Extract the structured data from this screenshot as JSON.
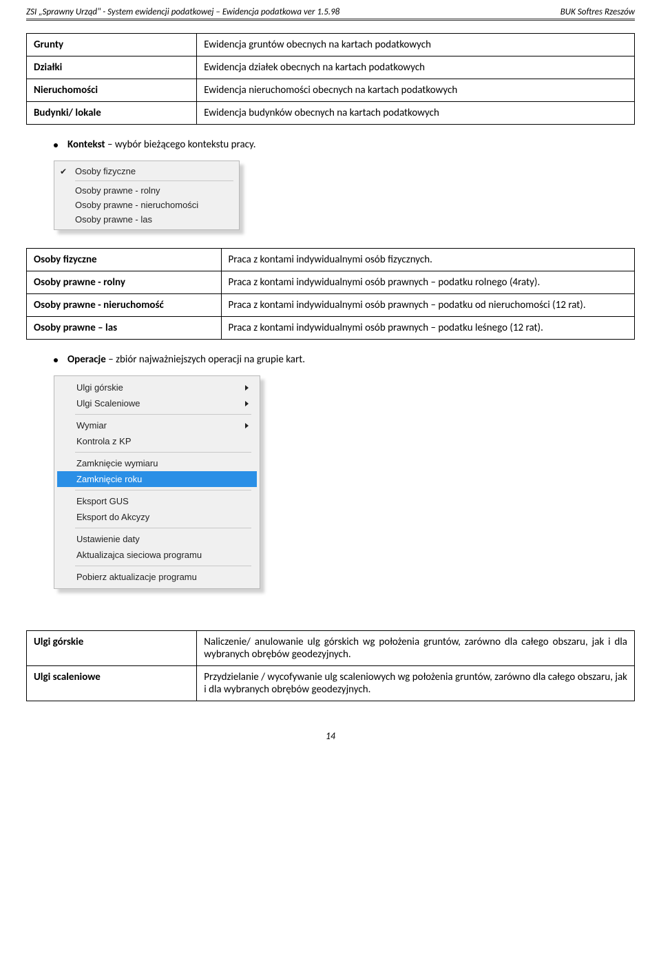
{
  "header": {
    "left": "ZSI „Sprawny Urząd\"  - System ewidencji podatkowej – Ewidencja podatkowa  ver 1.5.98",
    "right": "BUK Softres Rzeszów"
  },
  "table1": {
    "rows": [
      {
        "label": "Grunty",
        "desc": "Ewidencja gruntów obecnych na kartach podatkowych"
      },
      {
        "label": "Działki",
        "desc": "Ewidencja działek obecnych na kartach podatkowych"
      },
      {
        "label": "Nieruchomości",
        "desc": "Ewidencja nieruchomości obecnych na kartach podatkowych"
      },
      {
        "label": "Budynki/ lokale",
        "desc": "Ewidencja budynków obecnych na kartach podatkowych"
      }
    ]
  },
  "bullet1": {
    "bold": "Kontekst",
    "rest": " – wybór bieżącego kontekstu pracy."
  },
  "menuSmall": {
    "checked": "Osoby fizyczne",
    "items": [
      "Osoby prawne - rolny",
      "Osoby prawne - nieruchomości",
      "Osoby prawne - las"
    ]
  },
  "table2": {
    "rows": [
      {
        "label": "Osoby fizyczne",
        "desc": "Praca z kontami indywidualnymi osób fizycznych."
      },
      {
        "label": "Osoby prawne - rolny",
        "desc": "Praca z kontami indywidualnymi osób prawnych – podatku rolnego (4raty)."
      },
      {
        "label": "Osoby prawne - nieruchomość",
        "desc": "Praca z kontami indywidualnymi osób prawnych – podatku od nieruchomości  (12 rat)."
      },
      {
        "label": "Osoby prawne – las",
        "desc": "Praca z kontami indywidualnymi osób prawnych – podatku leśnego (12 rat)."
      }
    ]
  },
  "bullet2": {
    "bold": "Operacje",
    "rest": " – zbiór najważniejszych operacji na grupie kart."
  },
  "menuBig": {
    "items": [
      {
        "label": "Ulgi górskie",
        "arrow": true
      },
      {
        "label": "Ulgi Scaleniowe",
        "arrow": true
      },
      {
        "sep": true
      },
      {
        "label": "Wymiar",
        "arrow": true
      },
      {
        "label": "Kontrola z KP"
      },
      {
        "sep": true
      },
      {
        "label": "Zamknięcie wymiaru"
      },
      {
        "label": "Zamknięcie roku",
        "highlight": true
      },
      {
        "sep": true
      },
      {
        "label": "Eksport GUS"
      },
      {
        "label": "Eksport do Akcyzy"
      },
      {
        "sep": true
      },
      {
        "label": "Ustawienie daty"
      },
      {
        "label": "Aktualizajca sieciowa programu"
      },
      {
        "sep": true
      },
      {
        "label": "Pobierz aktualizacje programu"
      }
    ]
  },
  "table3": {
    "rows": [
      {
        "label": "Ulgi górskie",
        "desc": "Naliczenie/ anulowanie ulg górskich wg położenia gruntów, zarówno dla całego obszaru, jak i dla wybranych obrębów geodezyjnych."
      },
      {
        "label": "Ulgi scaleniowe",
        "desc": "Przydzielanie / wycofywanie ulg scaleniowych wg położenia gruntów, zarówno dla całego obszaru, jak i dla wybranych obrębów geodezyjnych."
      }
    ]
  },
  "pageNumber": "14"
}
